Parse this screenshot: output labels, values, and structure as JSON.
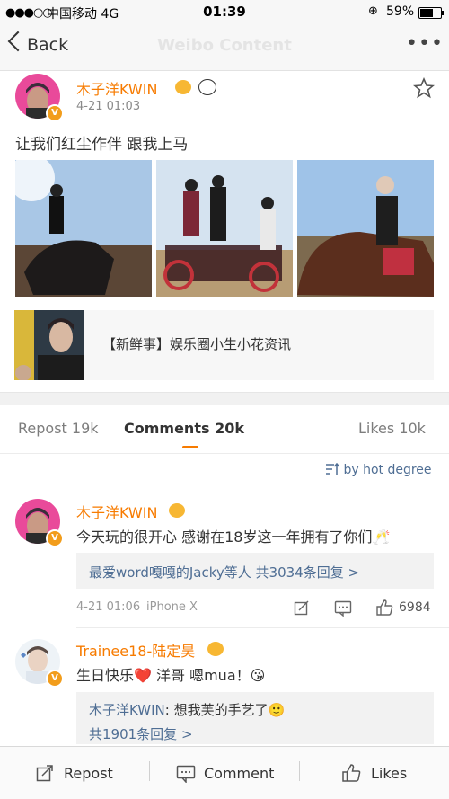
{
  "status_bar": {
    "signal": "●●●○○",
    "carrier": "中国移动  4G",
    "time": "01:39",
    "battery": "59%"
  },
  "nav": {
    "back_label": "Back",
    "title": "Weibo Content",
    "more_label": "•••"
  },
  "post": {
    "author": "木子洋KWIN",
    "time": "4-21 01:03",
    "text": "让我们红尘作伴 跟我上马",
    "share_card_text": "【新鲜事】娱乐圈小生小花资讯"
  },
  "tabs": {
    "repost": "Repost 19k",
    "comments": "Comments 20k",
    "likes": "Likes 10k"
  },
  "sort_label": "by hot degree",
  "comments": [
    {
      "author": "木子洋KWIN",
      "text": "今天玩的很开心 感谢在18岁这一年拥有了你们🥂",
      "reply_summary": "最爱word嘎嘎的Jacky等人  共3034条回复 >",
      "time": "4-21 01:06",
      "device": "iPhone X",
      "likes": "6984"
    },
    {
      "author": "Trainee18-陆定昊",
      "text": "生日快乐❤️  洋哥  嗯mua！😘",
      "reply_author": "木子洋KWIN",
      "reply_text": "想我芙的手艺了🙂",
      "reply_count": "共1901条回复 >"
    }
  ],
  "toolbar": {
    "repost": "Repost",
    "comment": "Comment",
    "likes": "Likes"
  },
  "colors": {
    "username": "#f77b00",
    "link": "#4f6e94",
    "verified": "#f29d1c"
  }
}
